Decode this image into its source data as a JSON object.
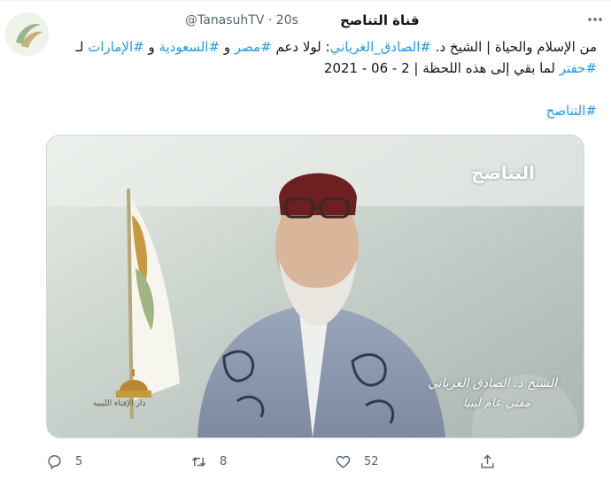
{
  "tweet": {
    "display_name": "قناة التناصح",
    "handle": "@TanasuhTV",
    "separator": "·",
    "time": "20s",
    "text": {
      "t1": "من الإسلام والحياة | الشيخ د. ",
      "h1": "#الصادق_الغرياني",
      "t2": ": لولا دعم ",
      "h2": "#مصر",
      "t3": " و ",
      "h3": "#السعودية",
      "t4": " و ",
      "h4": "#الإمارات",
      "t5": " لـ ",
      "h5": "#حفتر",
      "t6": " لما بقي إلى هذه اللحظة | 2 - 06 - 2021"
    },
    "hashtag_line": "#التناصح"
  },
  "media": {
    "logo_text": "التناصح",
    "caption_line1": "الشيخ د. الصادق الغرياني",
    "caption_line2": "مفتي عام ليبيا",
    "flag_text": "دار الإفتاء الليبية"
  },
  "actions": {
    "reply_count": "5",
    "retweet_count": "8",
    "like_count": "52"
  },
  "icons": {
    "reply": "reply-icon",
    "retweet": "retweet-icon",
    "like": "heart-icon",
    "share": "share-icon",
    "more": "more-icon"
  },
  "colors": {
    "link": "#1d9bf0",
    "muted": "#536471",
    "text": "#0f1419"
  }
}
